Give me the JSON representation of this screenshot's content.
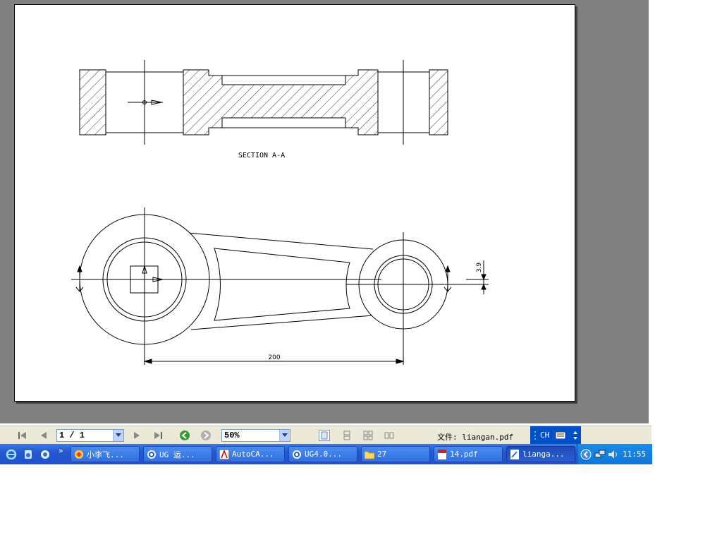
{
  "drawing": {
    "section_label": "SECTION A-A",
    "dim_200": "200",
    "dim_3_9": "3.9"
  },
  "nav": {
    "page_value": "1 / 1",
    "zoom_value": "50%",
    "file_label": "文件: liangan.pdf",
    "ime_label": "CH"
  },
  "taskbar": {
    "items": [
      {
        "label": "小李飞..."
      },
      {
        "label": "UG 运..."
      },
      {
        "label": "AutoCA..."
      },
      {
        "label": "UG4.0..."
      },
      {
        "label": "27"
      },
      {
        "label": "14.pdf"
      },
      {
        "label": "lianga..."
      }
    ],
    "clock": "11:55"
  }
}
